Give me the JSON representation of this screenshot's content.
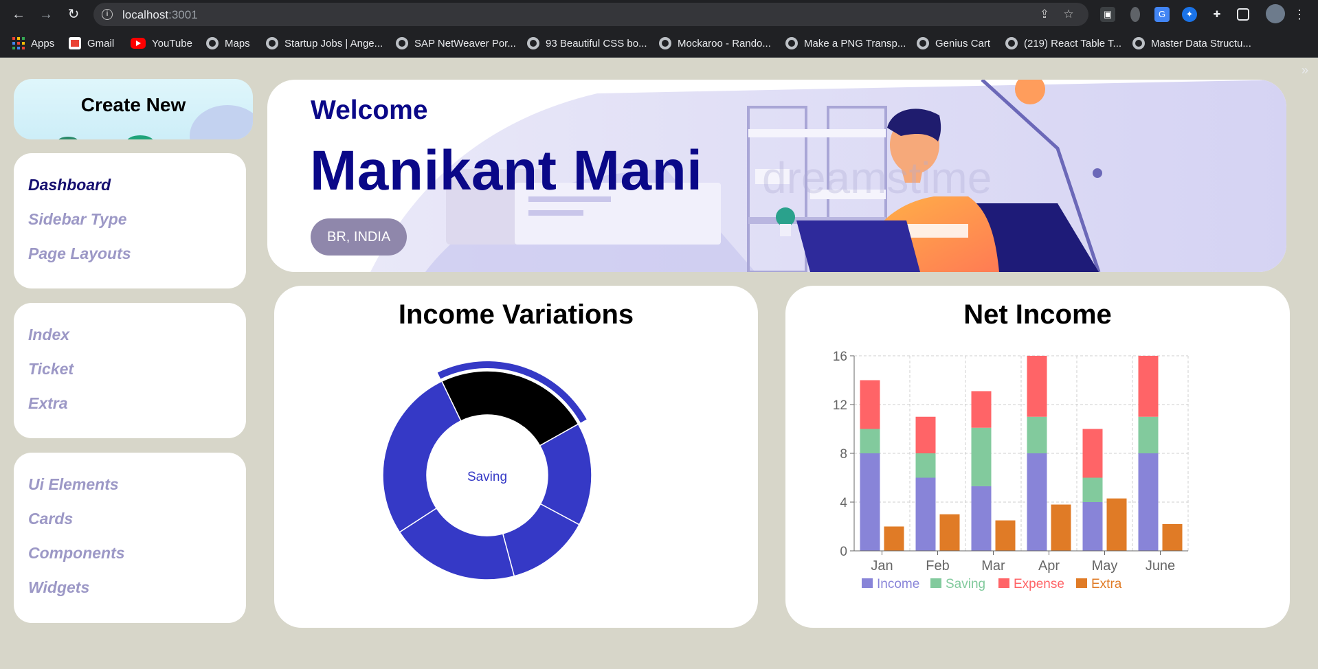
{
  "browser": {
    "url_host": "localhost",
    "url_port": ":3001",
    "bookmarks": [
      "Apps",
      "Gmail",
      "YouTube",
      "Maps",
      "Startup Jobs | Ange...",
      "SAP NetWeaver Por...",
      "93 Beautiful CSS bo...",
      "Mockaroo - Rando...",
      "Make a PNG Transp...",
      "Genius Cart",
      "(219) React Table T...",
      "Master Data Structu..."
    ]
  },
  "sidebar": {
    "create_label": "Create New",
    "group1": [
      "Dashboard",
      "Sidebar Type",
      "Page Layouts"
    ],
    "group2": [
      "Index",
      "Ticket",
      "Extra"
    ],
    "group3": [
      "Ui Elements",
      "Cards",
      "Components",
      "Widgets"
    ]
  },
  "banner": {
    "welcome": "Welcome",
    "name": "Manikant Mani",
    "location": "BR, INDIA"
  },
  "income_variations": {
    "title": "Income Variations",
    "center_label": "Saving",
    "colors": {
      "active": "#000000",
      "default": "#3539c6"
    },
    "chart_data": {
      "type": "pie",
      "variant": "donut",
      "active_slice": 0,
      "slices": [
        {
          "value": 24
        },
        {
          "value": 16
        },
        {
          "value": 13
        },
        {
          "value": 20
        },
        {
          "value": 27
        }
      ]
    }
  },
  "net_income": {
    "title": "Net Income",
    "chart_data": {
      "type": "bar",
      "stacked_series_plus_separate": true,
      "categories": [
        "Jan",
        "Feb",
        "Mar",
        "Apr",
        "May",
        "June"
      ],
      "ylim": [
        0,
        16
      ],
      "yticks": [
        0,
        4,
        8,
        12,
        16
      ],
      "grid": true,
      "legend": "bottom",
      "series": [
        {
          "name": "Income",
          "color": "#8884d8",
          "stack": "a",
          "values": [
            8,
            6,
            5.3,
            8,
            4,
            8
          ]
        },
        {
          "name": "Saving",
          "color": "#82ca9d",
          "stack": "a",
          "values": [
            2,
            2,
            4.8,
            3,
            2,
            3
          ]
        },
        {
          "name": "Expense",
          "color": "#ff6467",
          "stack": "a",
          "values": [
            4,
            3,
            3,
            5,
            4,
            5
          ]
        },
        {
          "name": "Extra",
          "color": "#e07b26",
          "stack": "b",
          "values": [
            2,
            3,
            2.5,
            3.8,
            4.3,
            2.2
          ]
        }
      ]
    }
  }
}
